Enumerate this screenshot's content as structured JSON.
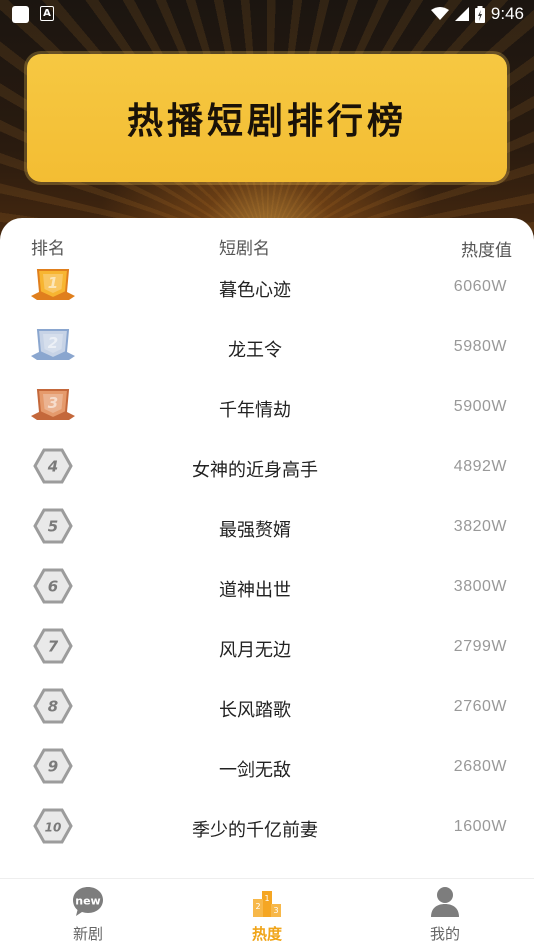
{
  "status_bar": {
    "time": "9:46"
  },
  "banner": {
    "title": "热播短剧排行榜"
  },
  "table": {
    "headers": {
      "rank": "排名",
      "name": "短剧名",
      "heat": "热度值"
    },
    "rows": [
      {
        "rank": "1",
        "name": "暮色心迹",
        "heat": "6060W"
      },
      {
        "rank": "2",
        "name": "龙王令",
        "heat": "5980W"
      },
      {
        "rank": "3",
        "name": "千年情劫",
        "heat": "5900W"
      },
      {
        "rank": "4",
        "name": "女神的近身高手",
        "heat": "4892W"
      },
      {
        "rank": "5",
        "name": "最强赘婿",
        "heat": "3820W"
      },
      {
        "rank": "6",
        "name": "道神出世",
        "heat": "3800W"
      },
      {
        "rank": "7",
        "name": "风月无边",
        "heat": "2799W"
      },
      {
        "rank": "8",
        "name": "长风踏歌",
        "heat": "2760W"
      },
      {
        "rank": "9",
        "name": "一剑无敌",
        "heat": "2680W"
      },
      {
        "rank": "10",
        "name": "季少的千亿前妻",
        "heat": "1600W"
      }
    ]
  },
  "tabbar": {
    "tabs": [
      {
        "label": "新剧",
        "icon": "new-icon",
        "badge_text": "new"
      },
      {
        "label": "热度",
        "icon": "podium-icon",
        "active": true
      },
      {
        "label": "我的",
        "icon": "user-icon"
      }
    ]
  },
  "colors": {
    "accent": "#f0a418",
    "banner": "#f4c23a",
    "gold": "#f2a52b",
    "silver": "#b9c6dc",
    "bronze": "#d98a5a",
    "gray_badge": "#9a9a9a"
  }
}
